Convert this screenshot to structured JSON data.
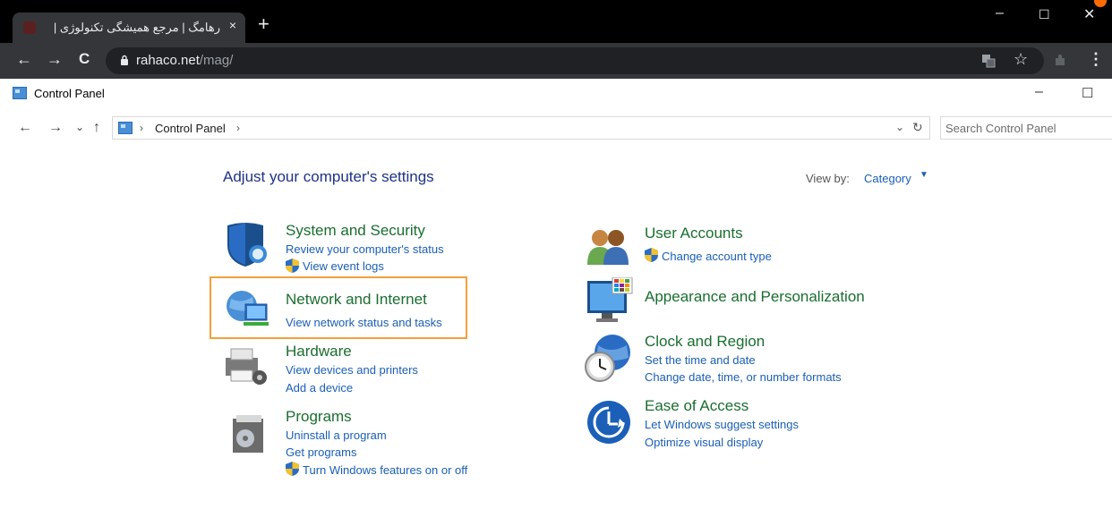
{
  "browser": {
    "tab_title": "رهامگ | مرجع همیشگی تکنولوژی |",
    "tab_close": "×",
    "new_tab": "+",
    "url_host": "rahaco.net",
    "url_path": "/mag/",
    "window_controls": {
      "minimize": "–",
      "maximize": "☐",
      "close": "✕"
    },
    "nav": {
      "back": "←",
      "forward": "→",
      "reload": "C"
    },
    "toolbar_icons": {
      "translate": "translate-icon",
      "bookmark": "☆",
      "extension": "extension-icon",
      "menu": "⋮"
    }
  },
  "window": {
    "title": "Control Panel",
    "minimize": "–",
    "maximize": "☐"
  },
  "address": {
    "back": "←",
    "forward": "→",
    "recent": "⌄",
    "up": "↑",
    "separator": "›",
    "crumb": "Control Panel",
    "dropdown": "⌄",
    "refresh": "↻",
    "search_placeholder": "Search Control Panel"
  },
  "content": {
    "heading": "Adjust your computer's settings",
    "view_by_label": "View by:",
    "view_by_value": "Category",
    "view_by_caret": "▼",
    "left_categories": [
      {
        "title": "System and Security",
        "links": [
          "Review your computer's status",
          "View event logs"
        ]
      },
      {
        "title": "Network and Internet",
        "links": [
          "View network status and tasks"
        ]
      },
      {
        "title": "Hardware",
        "links": [
          "View devices and printers",
          "Add a device"
        ]
      },
      {
        "title": "Programs",
        "links": [
          "Uninstall a program",
          "Get programs",
          "Turn Windows features on or off"
        ]
      }
    ],
    "right_categories": [
      {
        "title": "User Accounts",
        "links": [
          "Change account type"
        ]
      },
      {
        "title": "Appearance and Personalization",
        "links": []
      },
      {
        "title": "Clock and Region",
        "links": [
          "Set the time and date",
          "Change date, time, or number formats"
        ]
      },
      {
        "title": "Ease of Access",
        "links": [
          "Let Windows suggest settings",
          "Optimize visual display"
        ]
      }
    ]
  },
  "colors": {
    "chrome_dark": "#35363a",
    "category_title": "#1a6e30",
    "link": "#1a5fb4",
    "highlight": "#f3a03c"
  }
}
